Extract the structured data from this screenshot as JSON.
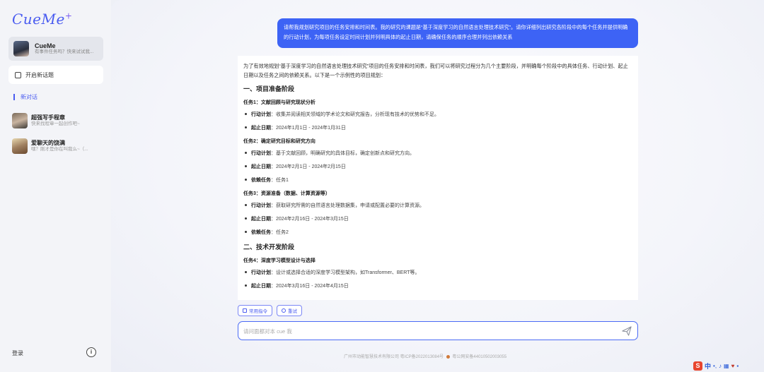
{
  "sidebar": {
    "logo": "CueMe",
    "logo_plus": "+",
    "bot": {
      "name": "CueMe",
      "subtitle": "有事件任务吗？快来试试我..."
    },
    "new_topic": "开启新话题",
    "new_chat": "新对话",
    "chats": [
      {
        "title": "超强写手程章",
        "subtitle": "快来找程章一起创作吧~"
      },
      {
        "title": "爱聊天的饶满",
        "subtitle": "嘿？刚才是你在叫我么~（..."
      }
    ],
    "login": "登录",
    "info": "i"
  },
  "main": {
    "user_message": "请帮我规划研究项目的任务安排和时间表。我的研究的课题是“基于深度学习的自然语言处理技术研究”。请你详细列出研究各阶段中的每个任务并提供明确的行动计划，为每项任务设定时间计划并列明具体的起止日期，请确保任务的顺序合理并列出依赖关系",
    "answer": {
      "intro": "为了有效地规划“基于深度学习的自然语言处理技术研究”项目的任务安排和时间表，我们可以将研究过程分为几个主要阶段，并明确每个阶段中的具体任务、行动计划、起止日期以及任务之间的依赖关系。以下是一个示例性的项目规划：",
      "phase1": "一、项目准备阶段",
      "task1": "任务1：文献回顾与研究现状分析",
      "task1_plan_label": "行动计划",
      "task1_plan": "：收集并阅读相关领域的学术论文和研究报告，分析现有技术的优势和不足。",
      "task1_date_label": "起止日期",
      "task1_date": "：2024年1月1日 - 2024年1月31日",
      "task2": "任务2：确定研究目标和研究方向",
      "task2_plan_label": "行动计划",
      "task2_plan": "：基于文献回顾，明确研究的具体目标，确定创新点和研究方向。",
      "task2_date_label": "起止日期",
      "task2_date": "：2024年2月1日 - 2024年2月15日",
      "task2_dep_label": "依赖任务",
      "task2_dep": "：任务1",
      "task3": "任务3：资源准备（数据、计算资源等）",
      "task3_plan_label": "行动计划",
      "task3_plan": "：获取研究所需的自然语言处理数据集，申请或配置必要的计算资源。",
      "task3_date_label": "起止日期",
      "task3_date": "：2024年2月16日 - 2024年3月15日",
      "task3_dep_label": "依赖任务",
      "task3_dep": "：任务2",
      "phase2": "二、技术开发阶段",
      "task4": "任务4：深度学习模型设计与选择",
      "task4_plan_label": "行动计划",
      "task4_plan": "：设计或选择合适的深度学习模型架构，如Transformer、BERT等。",
      "task4_date_label": "起止日期",
      "task4_date": "：2024年3月16日 - 2024年4月15日"
    },
    "chips": {
      "commands": "常用指令",
      "retry": "重试"
    },
    "input_placeholder": "请问面都对本 cue 我",
    "footer_left": "广州市动能智慧技术有限公司 粤ICP备2022013084号",
    "footer_right": "粤公网安备44010502003055"
  },
  "ime": {
    "s": "S",
    "lang": "中"
  }
}
